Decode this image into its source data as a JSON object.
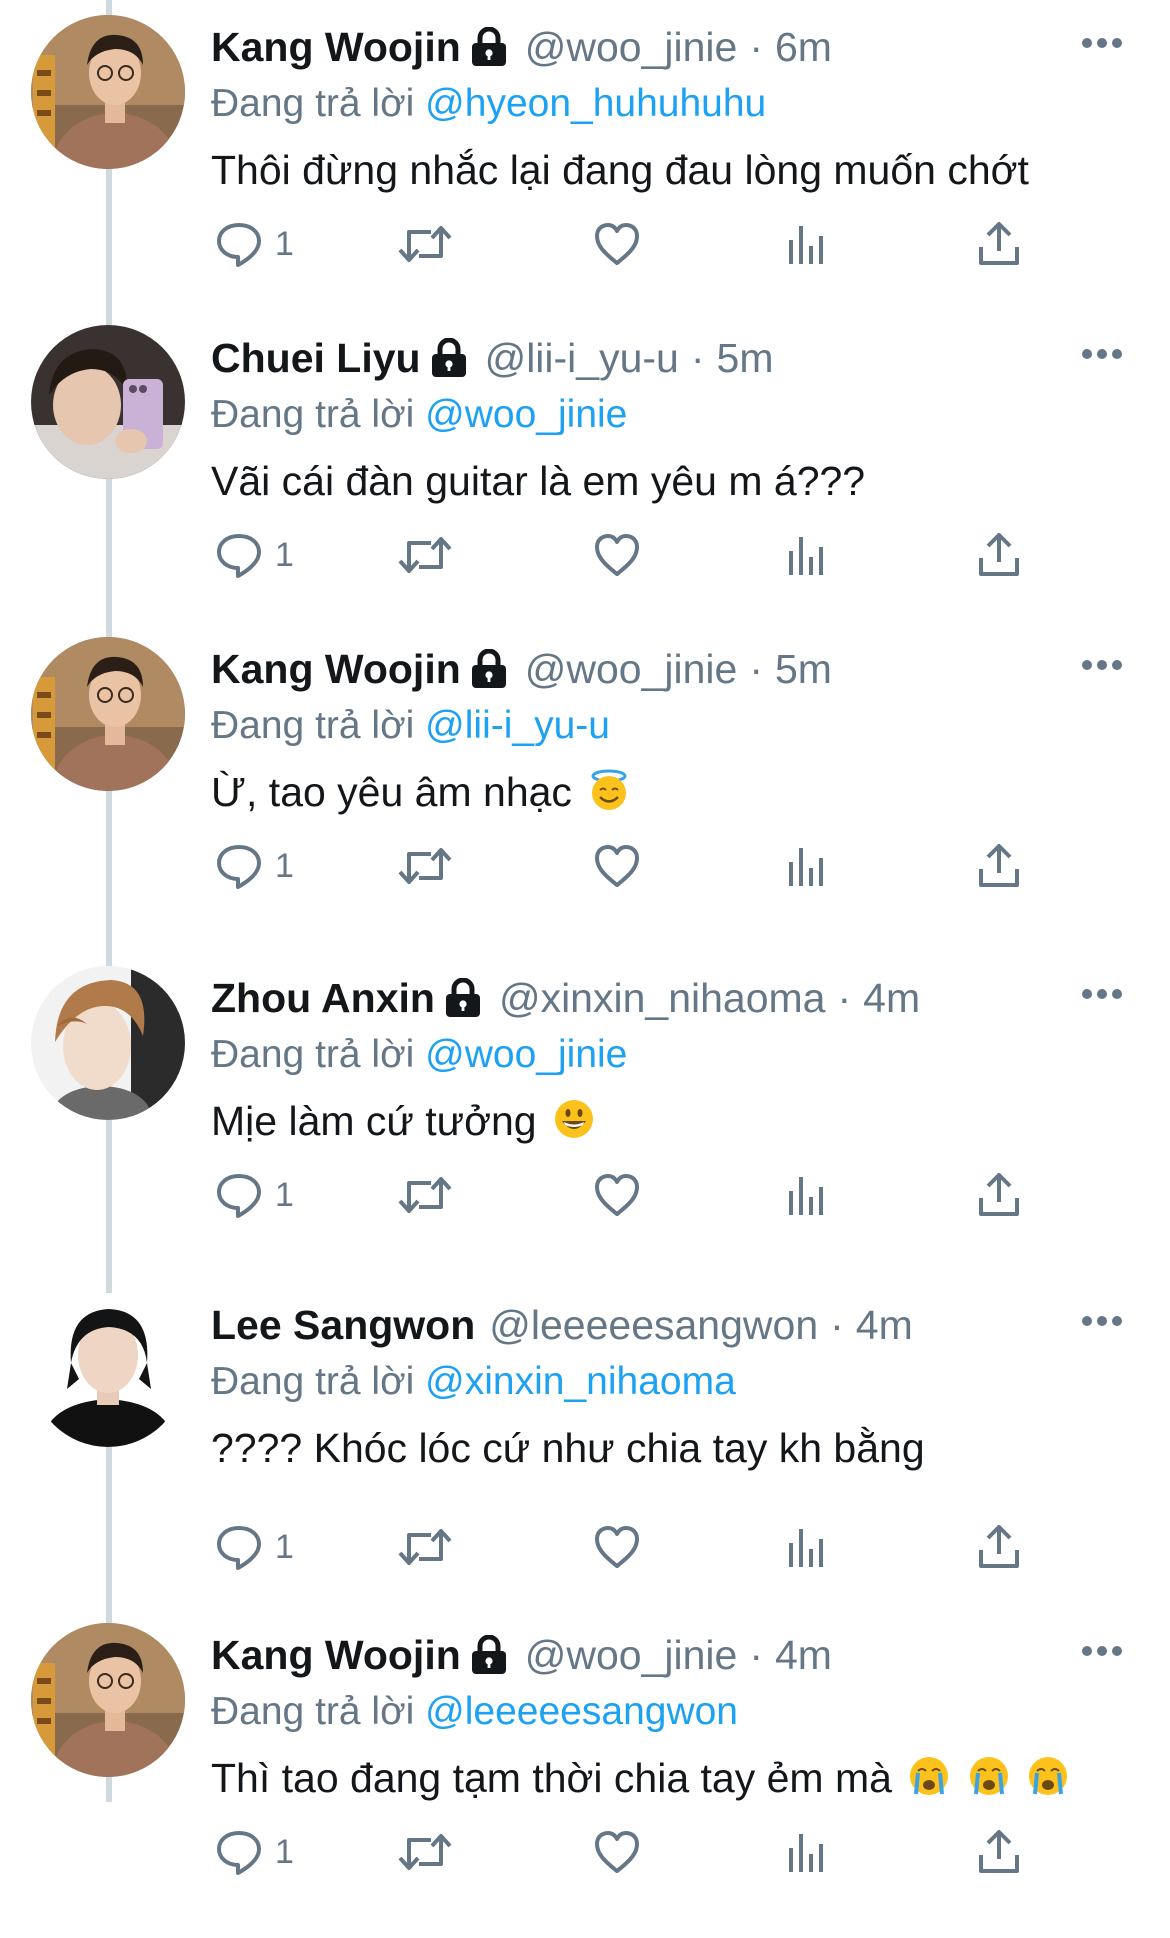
{
  "tweets": [
    {
      "name": "Kang Woojin",
      "handle": "@woo_jinie",
      "dot": "·",
      "time": "6m",
      "reply_prefix": "Đang trả lời",
      "reply_to": "@hyeon_huhuhuhu",
      "text": "Thôi đừng nhắc lại đang đau lòng muốn chớt",
      "reply_count": "1",
      "locked": true
    },
    {
      "name": "Chuei Liyu",
      "handle": "@lii-i_yu-u",
      "dot": "·",
      "time": "5m",
      "reply_prefix": "Đang trả lời",
      "reply_to": "@woo_jinie",
      "text": "Vãi cái đàn guitar là em yêu m á???",
      "reply_count": "1",
      "locked": true
    },
    {
      "name": "Kang Woojin",
      "handle": "@woo_jinie",
      "dot": "·",
      "time": "5m",
      "reply_prefix": "Đang trả lời",
      "reply_to": "@lii-i_yu-u",
      "text": "Ừ, tao yêu âm nhạc",
      "emojis": [
        "smiling-face-with-halo"
      ],
      "reply_count": "1",
      "locked": true
    },
    {
      "name": "Zhou Anxin",
      "handle": "@xinxin_nihaoma",
      "dot": "·",
      "time": "4m",
      "reply_prefix": "Đang trả lời",
      "reply_to": "@woo_jinie",
      "text": "Mịe làm cứ tưởng",
      "emojis": [
        "grinning-face"
      ],
      "reply_count": "1",
      "locked": true
    },
    {
      "name": "Lee Sangwon",
      "handle": "@leeeeesangwon",
      "dot": "·",
      "time": "4m",
      "reply_prefix": "Đang trả lời",
      "reply_to": "@xinxin_nihaoma",
      "text": "???? Khóc lóc cứ như chia tay kh bằng",
      "reply_count": "1",
      "locked": false
    },
    {
      "name": "Kang Woojin",
      "handle": "@woo_jinie",
      "dot": "·",
      "time": "4m",
      "reply_prefix": "Đang trả lời",
      "reply_to": "@leeeeesangwon",
      "text": "Thì tao đang tạm thời chia tay ẻm mà",
      "emojis": [
        "loudly-crying-face",
        "loudly-crying-face",
        "loudly-crying-face"
      ],
      "reply_count": "1",
      "locked": true
    }
  ],
  "icons": {
    "more": "more-horizontal-icon",
    "lock": "lock-icon",
    "reply": "reply-bubble-icon",
    "retweet": "retweet-icon",
    "like": "heart-icon",
    "views": "analytics-bars-icon",
    "share": "share-upload-icon"
  },
  "colors": {
    "text": "#14171a",
    "secondary": "#657786",
    "mention": "#1da1f2",
    "thread_line": "#cfd9de"
  }
}
